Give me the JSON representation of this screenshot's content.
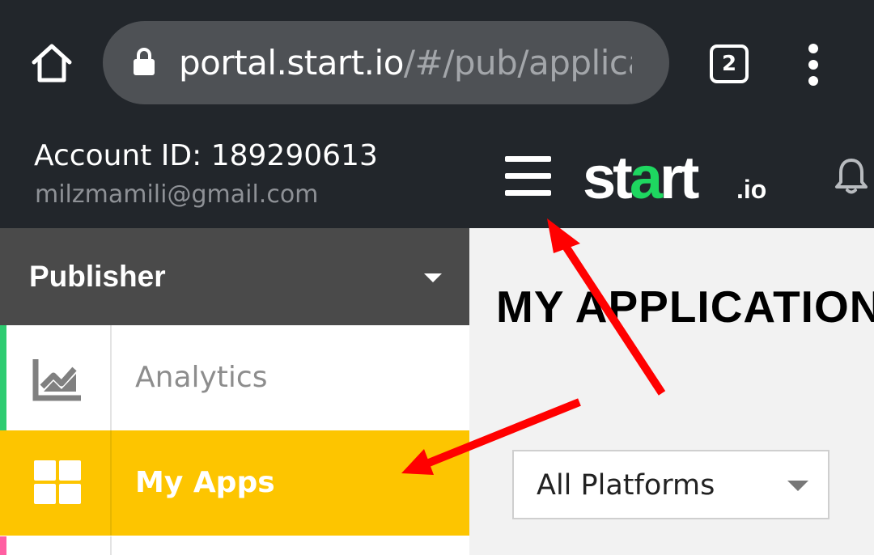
{
  "browser": {
    "url_host": "portal.start.io",
    "url_path": "/#/pub/applicati",
    "tab_count": "2",
    "icons": {
      "home": "home-icon",
      "lock": "lock-icon",
      "menu": "more-vertical-icon"
    }
  },
  "header": {
    "account_id": "Account ID: 189290613",
    "email": "milzmamili@gmail.com",
    "logo": {
      "main": "start",
      "suffix": ".io"
    },
    "icons": {
      "menu": "hamburger-menu-icon",
      "notifications": "bell-icon"
    }
  },
  "sidebar": {
    "section": "Publisher",
    "items": [
      {
        "label": "Analytics",
        "icon": "analytics-chart-icon",
        "accent": "#2ecc71",
        "active": false
      },
      {
        "label": "My Apps",
        "icon": "apps-grid-icon",
        "accent": "#fdc500",
        "active": true
      }
    ]
  },
  "main": {
    "title": "MY APPLICATIONS",
    "platform_filter": {
      "selected": "All Platforms"
    }
  },
  "colors": {
    "header_bg": "#22262b",
    "sidebar_section_bg": "#4a4a4a",
    "active_item_bg": "#fdc500",
    "logo_accent": "#1ed760",
    "annotation_arrow": "#ff0000"
  }
}
